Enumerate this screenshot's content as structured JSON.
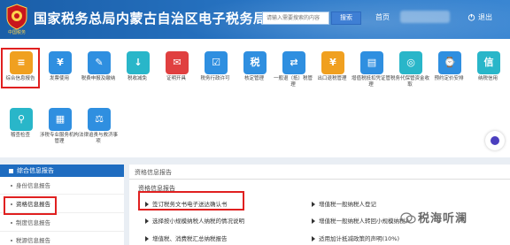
{
  "header": {
    "site_title": "国家税务总局内蒙古自治区电子税务局",
    "emblem_text": "中国税务",
    "search_placeholder": "请输入需要搜索的内容",
    "search_button": "搜索",
    "home_link": "首页",
    "exit_link": "退出"
  },
  "functions_row1": [
    {
      "label": "综合信息报告",
      "icon": "report-icon",
      "color": "#f0a020",
      "glyph": "≡"
    },
    {
      "label": "发票使用",
      "icon": "invoice-icon",
      "color": "#2f8fe0",
      "glyph": "¥"
    },
    {
      "label": "税费申报及缴纳",
      "icon": "tax-declare-icon",
      "color": "#2f8fe0",
      "glyph": "✎"
    },
    {
      "label": "税收减免",
      "icon": "tax-reduction-icon",
      "color": "#29b6c9",
      "glyph": "↓"
    },
    {
      "label": "证明开具",
      "icon": "certificate-icon",
      "color": "#e04040",
      "glyph": "✉"
    },
    {
      "label": "税务行政许可",
      "icon": "license-icon",
      "color": "#2f8fe0",
      "glyph": "☑"
    },
    {
      "label": "核定管理",
      "icon": "assessment-icon",
      "color": "#2f8fe0",
      "glyph": "税"
    },
    {
      "label": "一般退（抵）税管理",
      "icon": "refund-icon",
      "color": "#2f8fe0",
      "glyph": "⇄"
    },
    {
      "label": "出口退税管理",
      "icon": "export-refund-icon",
      "color": "#f0a020",
      "glyph": "¥"
    },
    {
      "label": "增值税抵扣凭证管理",
      "icon": "vat-voucher-icon",
      "color": "#2f8fe0",
      "glyph": "▤"
    },
    {
      "label": "税务代保管资金收取",
      "icon": "custody-fund-icon",
      "color": "#29b6c9",
      "glyph": "◎"
    },
    {
      "label": "预约定价安排",
      "icon": "pricing-icon",
      "color": "#2f8fe0",
      "glyph": "⌚"
    },
    {
      "label": "纳税信用",
      "icon": "credit-icon",
      "color": "#29b6c9",
      "glyph": "信"
    }
  ],
  "functions_row2": [
    {
      "label": "稽查检查",
      "icon": "inspection-icon",
      "color": "#29b6c9",
      "glyph": "⚲"
    },
    {
      "label": "涉税专业服务机构管理",
      "icon": "agency-icon",
      "color": "#2f8fe0",
      "glyph": "▦"
    },
    {
      "label": "法律追责与救济事项",
      "icon": "legal-icon",
      "color": "#2f8fe0",
      "glyph": "⚖"
    }
  ],
  "leftnav": {
    "header": "综合信息报告",
    "items": [
      "身份信息报告",
      "资格信息报告",
      "制度信息报告",
      "税源信息报告"
    ]
  },
  "main": {
    "panel_title": "资格信息报告",
    "section_title": "资格信息报告",
    "links_left": [
      "签订税务文书电子送达确认书",
      "选择按小规模纳税人纳税的情况说明",
      "增值税、消费税汇总纳税报告"
    ],
    "links_right": [
      "增值税一般纳税人登记",
      "增值税一般纳税人转回小规模纳税人",
      "适用加计抵减政策的声明(10%)"
    ]
  },
  "watermark": "税海听澜"
}
